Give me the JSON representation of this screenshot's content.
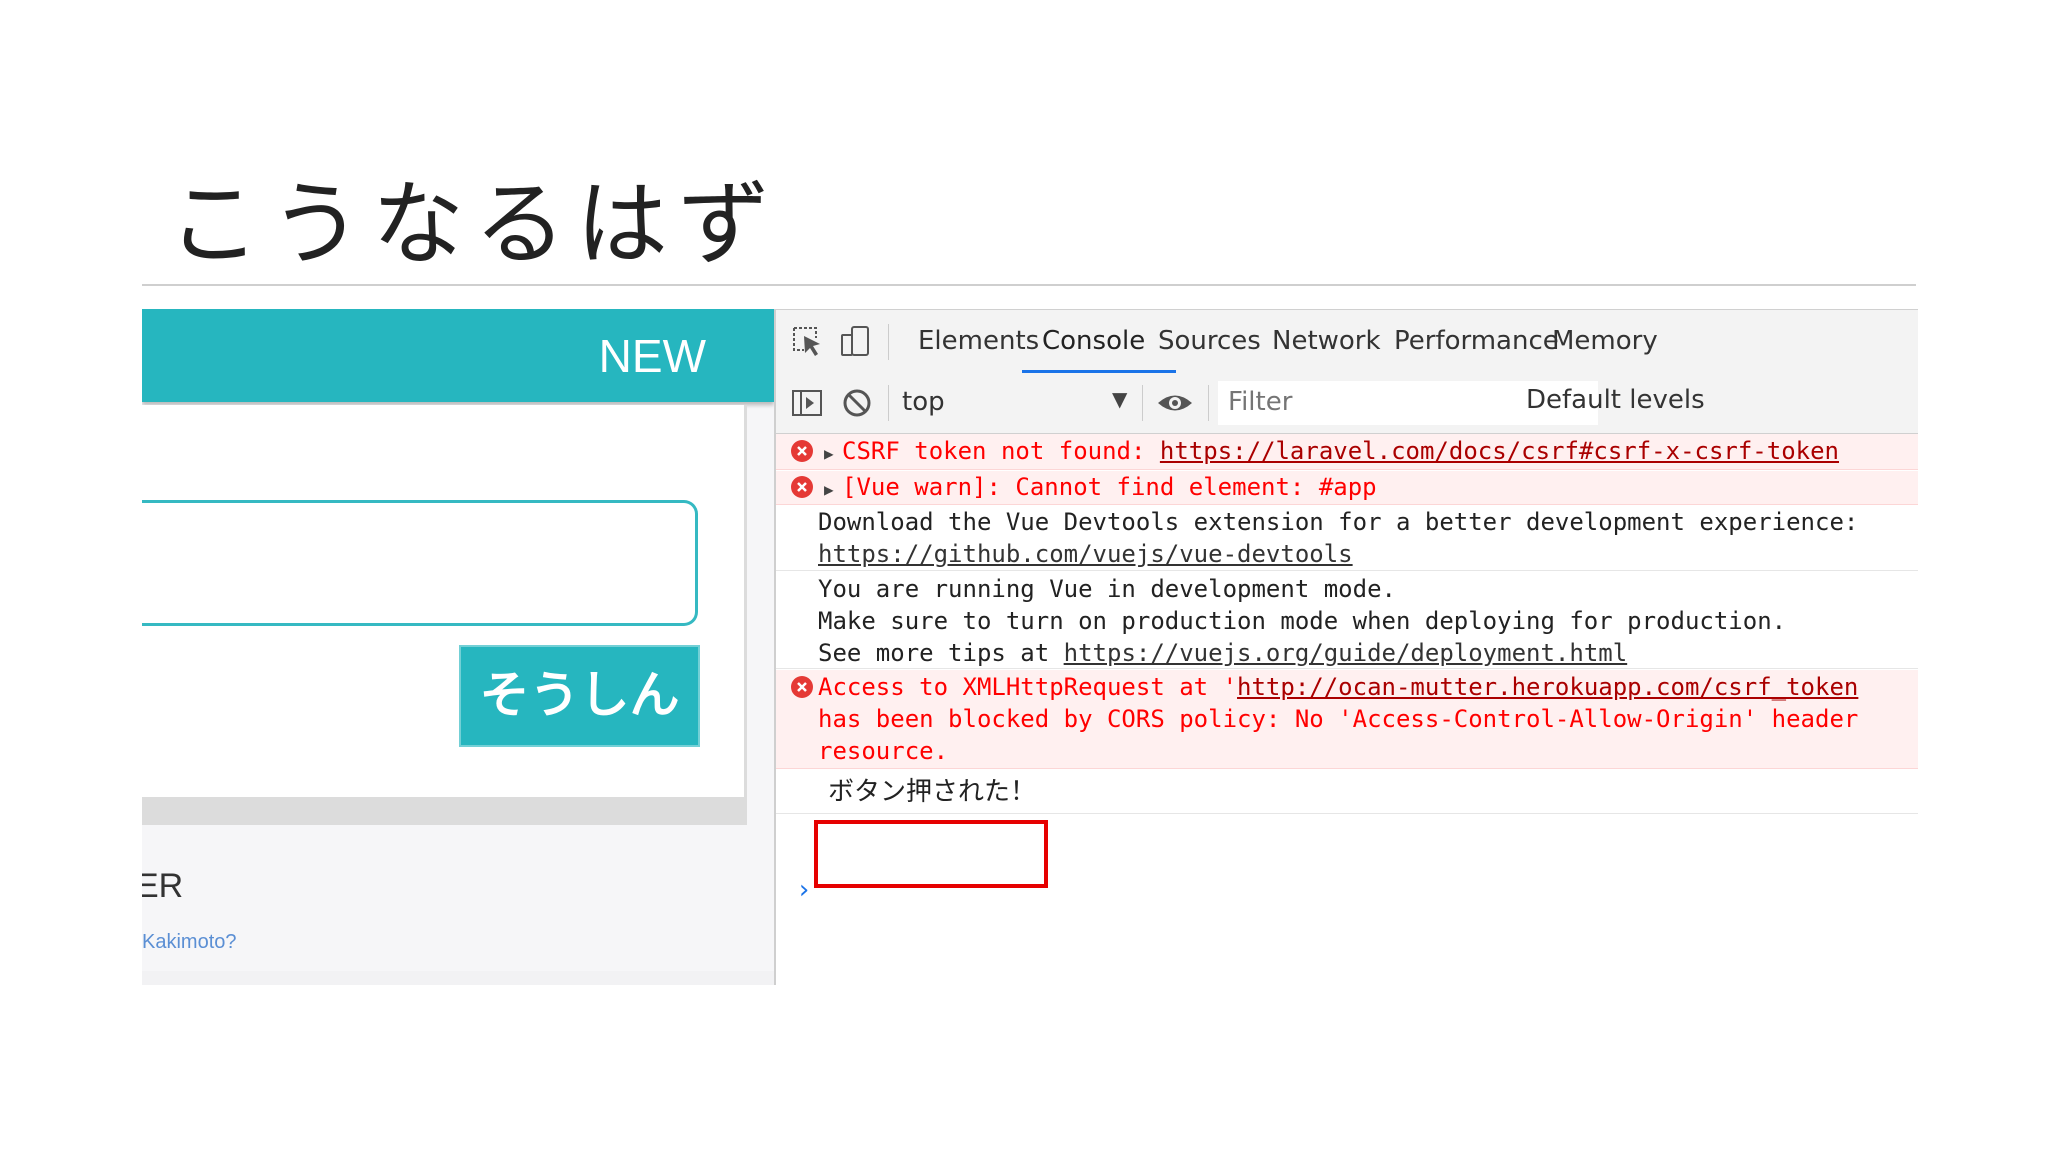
{
  "slide": {
    "title": "こうなるはず"
  },
  "app": {
    "header_label": "NEW",
    "submit_label": "そうしん",
    "side_label": "ER",
    "link_text": "Kakimoto?"
  },
  "devtools": {
    "tabs": [
      {
        "label": "Elements"
      },
      {
        "label": "Console",
        "active": true
      },
      {
        "label": "Sources"
      },
      {
        "label": "Network"
      },
      {
        "label": "Performance"
      },
      {
        "label": "Memory"
      }
    ],
    "context": "top",
    "filter_placeholder": "Filter",
    "levels_label": "Default levels",
    "messages": {
      "csrf": {
        "text": "CSRF token not found: ",
        "url": "https://laravel.com/docs/csrf#csrf-x-csrf-token"
      },
      "vue_warn": {
        "text": "[Vue warn]: Cannot find element: #app"
      },
      "devtools_hint": {
        "line1": "Download the Vue Devtools extension for a better development experience:",
        "url": "https://github.com/vuejs/vue-devtools"
      },
      "dev_mode": {
        "line1": "You are running Vue in development mode.",
        "line2": "Make sure to turn on production mode when deploying for production.",
        "line3_prefix": "See more tips at ",
        "url": "https://vuejs.org/guide/deployment.html"
      },
      "cors": {
        "line1_prefix": "Access to XMLHttpRequest at '",
        "url": "http://ocan-mutter.herokuapp.com/csrf_token",
        "line2": "has been blocked by CORS policy: No 'Access-Control-Allow-Origin' header",
        "line3": "resource."
      },
      "button_pressed": {
        "text": "ボタン押された！"
      }
    },
    "prompt_symbol": "›",
    "colors": {
      "accent": "#26b6bf",
      "error": "#ff0000",
      "highlight": "#e60000",
      "tab_active": "#1a73e8"
    }
  }
}
